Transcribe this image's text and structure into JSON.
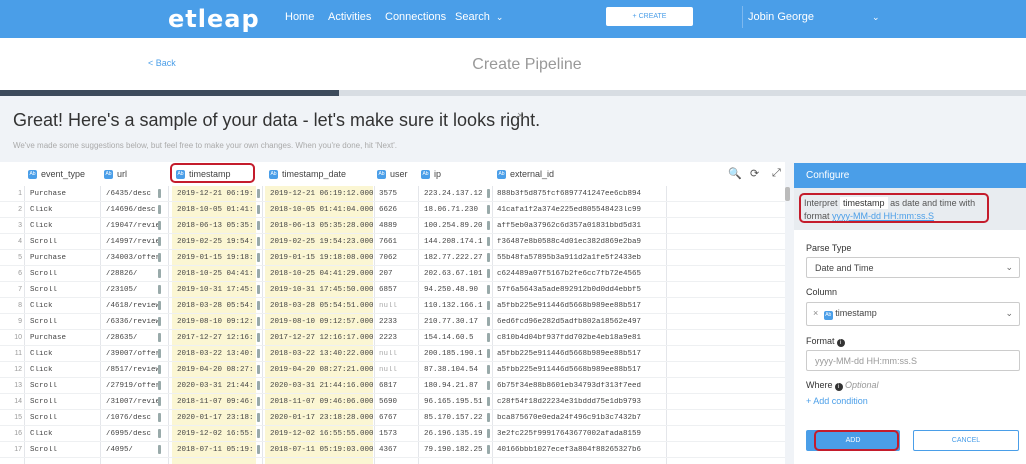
{
  "app": {
    "logo": "etleap",
    "nav": [
      "Home",
      "Activities",
      "Connections",
      "Search"
    ],
    "create_label": "+ CREATE",
    "user": "Jobin George"
  },
  "subheader": {
    "back": "< Back",
    "title": "Create Pipeline"
  },
  "progress_fraction": 0.33,
  "intro": {
    "headline": "Great! Here's a sample of your data - let's make sure it looks right.",
    "dismiss": "×",
    "subline": "We've made some suggestions below, but feel free to make your own changes. When you're done, hit 'Next'."
  },
  "grid": {
    "columns": [
      "event_type",
      "url",
      "timestamp",
      "timestamp_date",
      "user",
      "ip",
      "external_id"
    ],
    "row_numbers": [
      "1",
      "2",
      "3",
      "4",
      "5",
      "6",
      "7",
      "8",
      "9",
      "10",
      "11",
      "12",
      "13",
      "14",
      "15",
      "16",
      "17"
    ],
    "rows": [
      [
        "Purchase",
        "/6435/desc",
        "2019-12-21 06:19:",
        "2019-12-21 06:19:12.000",
        "3575",
        "223.24.137.12",
        "888b3f5d875fcf6897741247ee6cb894"
      ],
      [
        "Click",
        "/14696/desc",
        "2018-10-05 01:41:",
        "2018-10-05 01:41:04.000",
        "6626",
        "18.06.71.230",
        "41cafa1f2a374e225ed805548423lc99"
      ],
      [
        "Click",
        "/19047/revie",
        "2018-06-13 05:35:",
        "2018-06-13 05:35:28.000",
        "4889",
        "100.254.89.20",
        "aff5eb0a37962c6d357a01831bbd5d31"
      ],
      [
        "Scroll",
        "/14997/revie",
        "2019-02-25 19:54:",
        "2019-02-25 19:54:23.000",
        "7661",
        "144.208.174.1",
        "f36487e8b0588c4d01ec382d869e2ba9"
      ],
      [
        "Purchase",
        "/34003/offer",
        "2019-01-15 19:18:",
        "2019-01-15 19:18:08.000",
        "7062",
        "182.77.222.27",
        "55b48fa57895b3a911d2a1fe5f2433eb"
      ],
      [
        "Scroll",
        "/28826/",
        "2018-10-25 04:41:",
        "2018-10-25 04:41:29.000",
        "207",
        "202.63.67.101",
        "c624489a07f5167b2fe6cc7fb72e4565"
      ],
      [
        "Scroll",
        "/23105/",
        "2019-10-31 17:45:",
        "2019-10-31 17:45:50.000",
        "6857",
        "94.250.48.90",
        "57f6a5643a5ade892912b0d0dd4ebbf5"
      ],
      [
        "Click",
        "/4618/review",
        "2018-03-28 05:54:",
        "2018-03-28 05:54:51.000",
        "null",
        "110.132.166.1",
        "a5fbb225e911446d5668b989ee88b517"
      ],
      [
        "Scroll",
        "/6336/review",
        "2019-08-10 09:12:",
        "2019-08-10 09:12:57.000",
        "2233",
        "210.77.30.17",
        "6ed6fcd96e282d5adfb802a18562e497"
      ],
      [
        "Purchase",
        "/28635/",
        "2017-12-27 12:16:",
        "2017-12-27 12:16:17.000",
        "2223",
        "154.14.60.5",
        "c810b4d04bf937fdd702be4eb18a9e81"
      ],
      [
        "Click",
        "/39007/offer",
        "2018-03-22 13:40:",
        "2018-03-22 13:40:22.000",
        "null",
        "200.185.190.1",
        "a5fbb225e911446d5668b989ee88b517"
      ],
      [
        "Click",
        "/8517/review",
        "2019-04-20 08:27:",
        "2019-04-20 08:27:21.000",
        "null",
        "87.38.104.54",
        "a5fbb225e911446d5668b989ee88b517"
      ],
      [
        "Scroll",
        "/27919/offer",
        "2020-03-31 21:44:",
        "2020-03-31 21:44:16.000",
        "6817",
        "180.94.21.87",
        "6b75f34e88b8601eb34793df313f7eed"
      ],
      [
        "Scroll",
        "/31007/revie",
        "2018-11-07 09:46:",
        "2018-11-07 09:46:06.000",
        "5690",
        "96.165.195.51",
        "c28f54f18d22234e31bddd75e1db9793"
      ],
      [
        "Scroll",
        "/1076/desc",
        "2020-01-17 23:18:",
        "2020-01-17 23:18:28.000",
        "6767",
        "85.170.157.22",
        "bca875670e0eda24f496c91b3c7432b7"
      ],
      [
        "Click",
        "/6995/desc",
        "2019-12-02 16:55:",
        "2019-12-02 16:55:55.000",
        "1573",
        "26.196.135.19",
        "3e2fc225f99917643677002afada8159"
      ],
      [
        "Scroll",
        "/4095/",
        "2018-07-11 05:19:",
        "2018-07-11 05:19:03.000",
        "4367",
        "79.190.182.25",
        "40166bbb1027ecef3a804f88265327b6"
      ]
    ]
  },
  "tools": {
    "zoom": "🔍",
    "refresh": "⟳",
    "expand": "⤢"
  },
  "panel": {
    "title": "Configure",
    "interpret_prefix": "Interpret",
    "interpret_column": "timestamp",
    "interpret_suffix": "as date and time with",
    "format_prefix": "format",
    "format_value": "yyyy-MM-dd HH:mm:ss.S",
    "parse_type_label": "Parse Type",
    "parse_type_value": "Date and Time",
    "column_label": "Column",
    "column_remove": "×",
    "column_value": "timestamp",
    "format_label": "Format",
    "format_input_value": "yyyy-MM-dd HH:mm:ss.S",
    "where_label": "Where",
    "where_optional": "Optional",
    "add_condition": "+ Add condition",
    "add_button": "ADD",
    "cancel_button": "CANCEL"
  }
}
